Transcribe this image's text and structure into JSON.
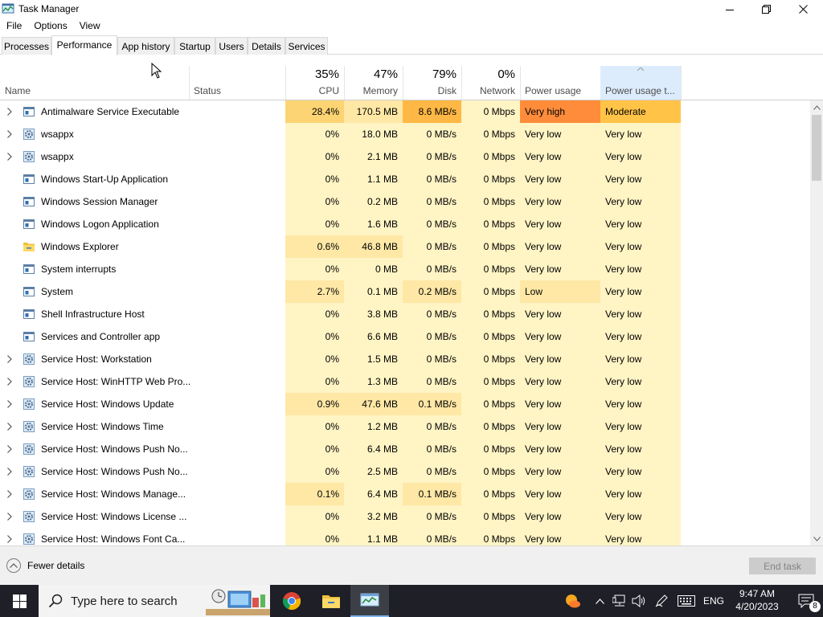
{
  "window": {
    "title": "Task Manager"
  },
  "menu": [
    "File",
    "Options",
    "View"
  ],
  "tabs": [
    {
      "label": "Processes",
      "active": false
    },
    {
      "label": "Performance",
      "active": true
    },
    {
      "label": "App history",
      "active": false
    },
    {
      "label": "Startup",
      "active": false
    },
    {
      "label": "Users",
      "active": false
    },
    {
      "label": "Details",
      "active": false
    },
    {
      "label": "Services",
      "active": false
    }
  ],
  "columns": {
    "name": "Name",
    "status": "Status",
    "cpu": {
      "pct": "35%",
      "label": "CPU"
    },
    "memory": {
      "pct": "47%",
      "label": "Memory"
    },
    "disk": {
      "pct": "79%",
      "label": "Disk"
    },
    "network": {
      "pct": "0%",
      "label": "Network"
    },
    "power": "Power usage",
    "power_trend": "Power usage t..."
  },
  "rows": [
    {
      "name": "Antimalware Service Executable",
      "expand": true,
      "icon": "window",
      "cpu": "28.4%",
      "mem": "170.5 MB",
      "disk": "8.6 MB/s",
      "net": "0 Mbps",
      "power": "Very high",
      "power_trend": "Moderate",
      "heat": {
        "cpu": 2,
        "mem": 1,
        "disk": 3,
        "net": 0,
        "power": 4,
        "power_trend": 5
      }
    },
    {
      "name": "wsappx",
      "expand": true,
      "icon": "gear",
      "cpu": "0%",
      "mem": "18.0 MB",
      "disk": "0 MB/s",
      "net": "0 Mbps",
      "power": "Very low",
      "power_trend": "Very low",
      "heat": {
        "cpu": 0,
        "mem": 0,
        "disk": 0,
        "net": 0,
        "power": 0,
        "power_trend": 0
      }
    },
    {
      "name": "wsappx",
      "expand": true,
      "icon": "gear",
      "cpu": "0%",
      "mem": "2.1 MB",
      "disk": "0 MB/s",
      "net": "0 Mbps",
      "power": "Very low",
      "power_trend": "Very low",
      "heat": {
        "cpu": 0,
        "mem": 0,
        "disk": 0,
        "net": 0,
        "power": 0,
        "power_trend": 0
      }
    },
    {
      "name": "Windows Start-Up Application",
      "expand": false,
      "icon": "window",
      "cpu": "0%",
      "mem": "1.1 MB",
      "disk": "0 MB/s",
      "net": "0 Mbps",
      "power": "Very low",
      "power_trend": "Very low",
      "heat": {
        "cpu": 0,
        "mem": 0,
        "disk": 0,
        "net": 0,
        "power": 0,
        "power_trend": 0
      }
    },
    {
      "name": "Windows Session Manager",
      "expand": false,
      "icon": "window",
      "cpu": "0%",
      "mem": "0.2 MB",
      "disk": "0 MB/s",
      "net": "0 Mbps",
      "power": "Very low",
      "power_trend": "Very low",
      "heat": {
        "cpu": 0,
        "mem": 0,
        "disk": 0,
        "net": 0,
        "power": 0,
        "power_trend": 0
      }
    },
    {
      "name": "Windows Logon Application",
      "expand": false,
      "icon": "window",
      "cpu": "0%",
      "mem": "1.6 MB",
      "disk": "0 MB/s",
      "net": "0 Mbps",
      "power": "Very low",
      "power_trend": "Very low",
      "heat": {
        "cpu": 0,
        "mem": 0,
        "disk": 0,
        "net": 0,
        "power": 0,
        "power_trend": 0
      }
    },
    {
      "name": "Windows Explorer",
      "expand": false,
      "icon": "folder",
      "cpu": "0.6%",
      "mem": "46.8 MB",
      "disk": "0 MB/s",
      "net": "0 Mbps",
      "power": "Very low",
      "power_trend": "Very low",
      "heat": {
        "cpu": 1,
        "mem": 1,
        "disk": 0,
        "net": 0,
        "power": 0,
        "power_trend": 0
      }
    },
    {
      "name": "System interrupts",
      "expand": false,
      "icon": "window",
      "cpu": "0%",
      "mem": "0 MB",
      "disk": "0 MB/s",
      "net": "0 Mbps",
      "power": "Very low",
      "power_trend": "Very low",
      "heat": {
        "cpu": 0,
        "mem": 0,
        "disk": 0,
        "net": 0,
        "power": 0,
        "power_trend": 0
      }
    },
    {
      "name": "System",
      "expand": false,
      "icon": "window",
      "cpu": "2.7%",
      "mem": "0.1 MB",
      "disk": "0.2 MB/s",
      "net": "0 Mbps",
      "power": "Low",
      "power_trend": "Very low",
      "heat": {
        "cpu": 1,
        "mem": 0,
        "disk": 1,
        "net": 0,
        "power": 1,
        "power_trend": 0
      }
    },
    {
      "name": "Shell Infrastructure Host",
      "expand": false,
      "icon": "window",
      "cpu": "0%",
      "mem": "3.8 MB",
      "disk": "0 MB/s",
      "net": "0 Mbps",
      "power": "Very low",
      "power_trend": "Very low",
      "heat": {
        "cpu": 0,
        "mem": 0,
        "disk": 0,
        "net": 0,
        "power": 0,
        "power_trend": 0
      }
    },
    {
      "name": "Services and Controller app",
      "expand": false,
      "icon": "window",
      "cpu": "0%",
      "mem": "6.6 MB",
      "disk": "0 MB/s",
      "net": "0 Mbps",
      "power": "Very low",
      "power_trend": "Very low",
      "heat": {
        "cpu": 0,
        "mem": 0,
        "disk": 0,
        "net": 0,
        "power": 0,
        "power_trend": 0
      }
    },
    {
      "name": "Service Host: Workstation",
      "expand": true,
      "icon": "gear",
      "cpu": "0%",
      "mem": "1.5 MB",
      "disk": "0 MB/s",
      "net": "0 Mbps",
      "power": "Very low",
      "power_trend": "Very low",
      "heat": {
        "cpu": 0,
        "mem": 0,
        "disk": 0,
        "net": 0,
        "power": 0,
        "power_trend": 0
      }
    },
    {
      "name": "Service Host: WinHTTP Web Pro...",
      "expand": true,
      "icon": "gear",
      "cpu": "0%",
      "mem": "1.3 MB",
      "disk": "0 MB/s",
      "net": "0 Mbps",
      "power": "Very low",
      "power_trend": "Very low",
      "heat": {
        "cpu": 0,
        "mem": 0,
        "disk": 0,
        "net": 0,
        "power": 0,
        "power_trend": 0
      }
    },
    {
      "name": "Service Host: Windows Update",
      "expand": true,
      "icon": "gear",
      "cpu": "0.9%",
      "mem": "47.6 MB",
      "disk": "0.1 MB/s",
      "net": "0 Mbps",
      "power": "Very low",
      "power_trend": "Very low",
      "heat": {
        "cpu": 1,
        "mem": 1,
        "disk": 1,
        "net": 0,
        "power": 0,
        "power_trend": 0
      }
    },
    {
      "name": "Service Host: Windows Time",
      "expand": true,
      "icon": "gear",
      "cpu": "0%",
      "mem": "1.2 MB",
      "disk": "0 MB/s",
      "net": "0 Mbps",
      "power": "Very low",
      "power_trend": "Very low",
      "heat": {
        "cpu": 0,
        "mem": 0,
        "disk": 0,
        "net": 0,
        "power": 0,
        "power_trend": 0
      }
    },
    {
      "name": "Service Host: Windows Push No...",
      "expand": true,
      "icon": "gear",
      "cpu": "0%",
      "mem": "6.4 MB",
      "disk": "0 MB/s",
      "net": "0 Mbps",
      "power": "Very low",
      "power_trend": "Very low",
      "heat": {
        "cpu": 0,
        "mem": 0,
        "disk": 0,
        "net": 0,
        "power": 0,
        "power_trend": 0
      }
    },
    {
      "name": "Service Host: Windows Push No...",
      "expand": true,
      "icon": "gear",
      "cpu": "0%",
      "mem": "2.5 MB",
      "disk": "0 MB/s",
      "net": "0 Mbps",
      "power": "Very low",
      "power_trend": "Very low",
      "heat": {
        "cpu": 0,
        "mem": 0,
        "disk": 0,
        "net": 0,
        "power": 0,
        "power_trend": 0
      }
    },
    {
      "name": "Service Host: Windows Manage...",
      "expand": true,
      "icon": "gear",
      "cpu": "0.1%",
      "mem": "6.4 MB",
      "disk": "0.1 MB/s",
      "net": "0 Mbps",
      "power": "Very low",
      "power_trend": "Very low",
      "heat": {
        "cpu": 1,
        "mem": 0,
        "disk": 1,
        "net": 0,
        "power": 0,
        "power_trend": 0
      }
    },
    {
      "name": "Service Host: Windows License ...",
      "expand": true,
      "icon": "gear",
      "cpu": "0%",
      "mem": "3.2 MB",
      "disk": "0 MB/s",
      "net": "0 Mbps",
      "power": "Very low",
      "power_trend": "Very low",
      "heat": {
        "cpu": 0,
        "mem": 0,
        "disk": 0,
        "net": 0,
        "power": 0,
        "power_trend": 0
      }
    },
    {
      "name": "Service Host: Windows Font Ca...",
      "expand": true,
      "icon": "gear",
      "cpu": "0%",
      "mem": "1.1 MB",
      "disk": "0 MB/s",
      "net": "0 Mbps",
      "power": "Very low",
      "power_trend": "Very low",
      "heat": {
        "cpu": 0,
        "mem": 0,
        "disk": 0,
        "net": 0,
        "power": 0,
        "power_trend": 0
      }
    }
  ],
  "footer": {
    "fewer_details": "Fewer details",
    "end_task": "End task"
  },
  "taskbar": {
    "search_placeholder": "Type here to search",
    "language": "ENG",
    "time": "9:47 AM",
    "date": "4/20/2023",
    "notification_count": "8"
  },
  "colors": {
    "heat": [
      "#fff4c4",
      "#ffe8a6",
      "#fcd474",
      "#ffb845",
      "#ff8c3b",
      "#ffc447"
    ],
    "taskbar": "#1e1f27",
    "accent": "#7eb4ea"
  }
}
